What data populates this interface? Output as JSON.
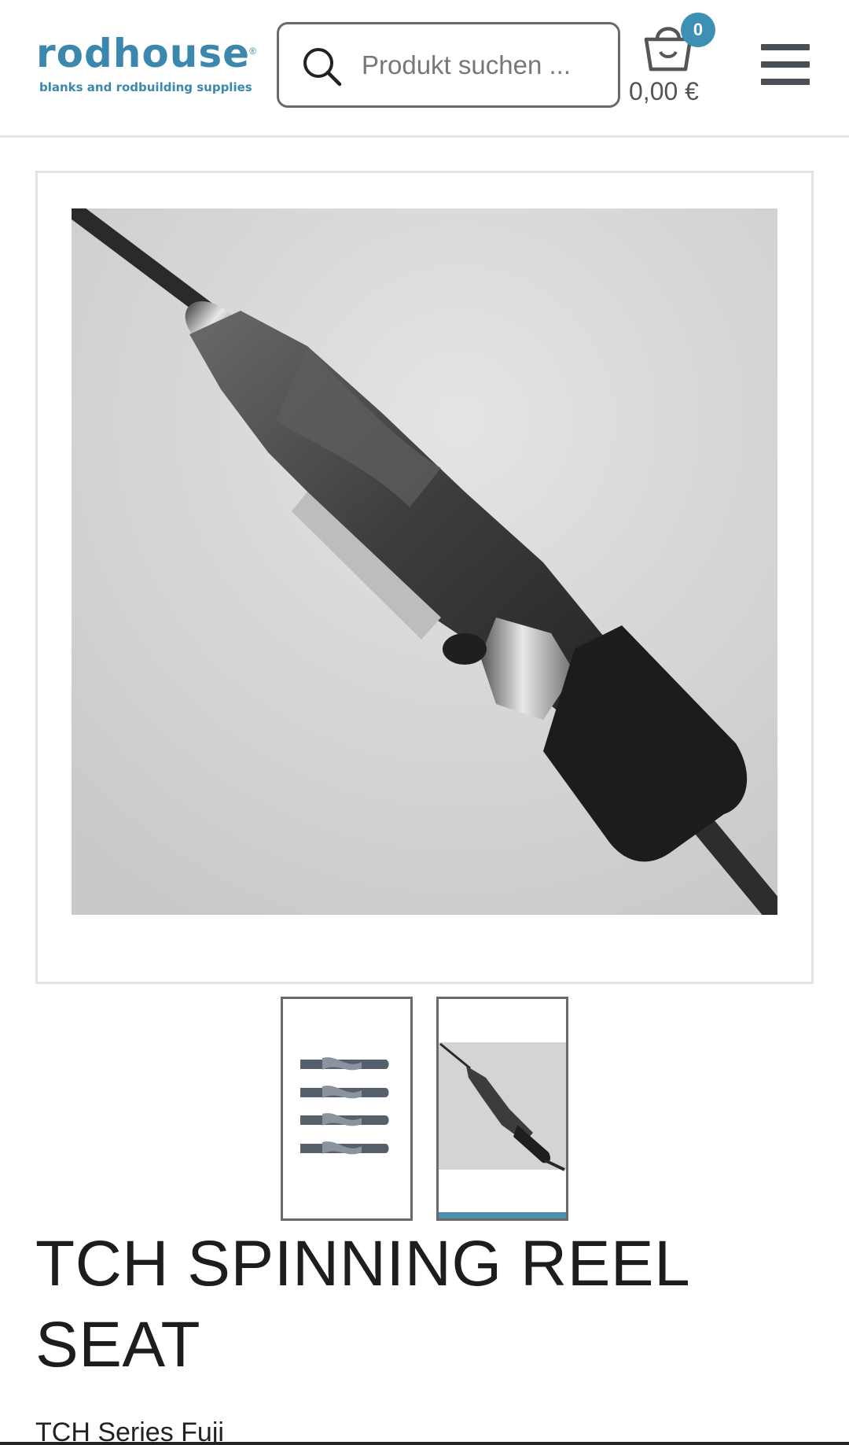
{
  "header": {
    "logo": {
      "word": "rodhouse",
      "registered": "®",
      "tagline": "blanks and rodbuilding supplies"
    },
    "search": {
      "placeholder": "Produkt suchen ...",
      "icon": "search-icon"
    },
    "cart": {
      "count": "0",
      "total": "0,00 €",
      "icon": "basket-icon"
    },
    "menu": {
      "icon": "hamburger-menu-icon"
    }
  },
  "gallery": {
    "thumbnails": [
      {
        "alt": "4 reel seats",
        "active": false
      },
      {
        "alt": "reel seat on rod",
        "active": true
      }
    ],
    "active_index": 1
  },
  "product": {
    "title": "TCH SPINNING REEL SEAT",
    "subtitle": "TCH Series Fuji"
  },
  "colors": {
    "brand": "#3b87ad",
    "badge": "#3d8fb3",
    "active_thumb": "#4a8fb0",
    "text": "#1d1d1d"
  }
}
